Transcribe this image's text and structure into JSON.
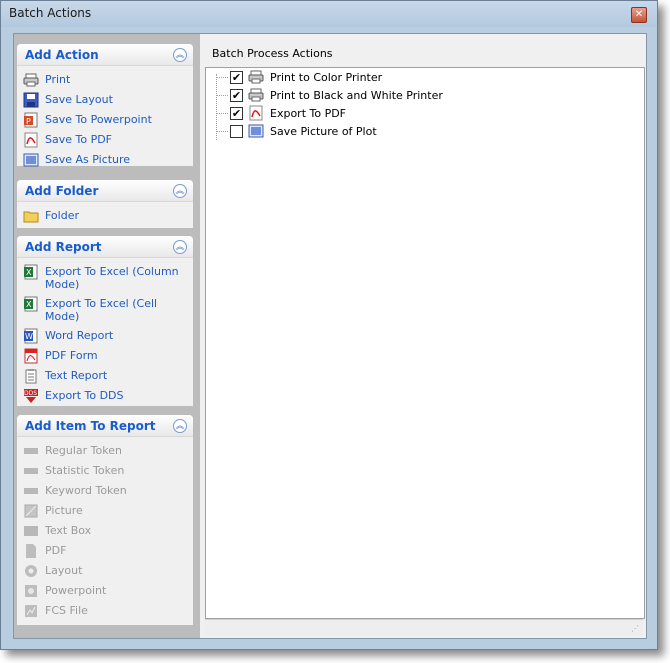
{
  "window": {
    "title": "Batch Actions"
  },
  "groups": {
    "add_action": {
      "title": "Add Action",
      "items": [
        {
          "label": "Print",
          "icon": "printer-icon"
        },
        {
          "label": "Save Layout",
          "icon": "floppy-disk-icon"
        },
        {
          "label": "Save To Powerpoint",
          "icon": "powerpoint-icon"
        },
        {
          "label": "Save To PDF",
          "icon": "pdf-icon"
        },
        {
          "label": "Save As Picture",
          "icon": "picture-icon"
        }
      ]
    },
    "add_folder": {
      "title": "Add Folder",
      "items": [
        {
          "label": "Folder",
          "icon": "folder-icon"
        }
      ]
    },
    "add_report": {
      "title": "Add Report",
      "items": [
        {
          "label": "Export To Excel (Column Mode)",
          "icon": "excel-column-icon"
        },
        {
          "label": "Export To Excel (Cell Mode)",
          "icon": "excel-cell-icon"
        },
        {
          "label": "Word Report",
          "icon": "word-icon"
        },
        {
          "label": "PDF Form",
          "icon": "pdf-form-icon"
        },
        {
          "label": "Text Report",
          "icon": "text-report-icon"
        },
        {
          "label": "Export To DDS",
          "icon": "dds-icon"
        }
      ]
    },
    "add_item_to_report": {
      "title": "Add Item To Report",
      "items": [
        {
          "label": "Regular Token",
          "icon": "token-icon"
        },
        {
          "label": "Statistic Token",
          "icon": "token-icon"
        },
        {
          "label": "Keyword Token",
          "icon": "token-icon"
        },
        {
          "label": "Picture",
          "icon": "picture-icon"
        },
        {
          "label": "Text Box",
          "icon": "text-box-icon"
        },
        {
          "label": "PDF",
          "icon": "pdf-icon"
        },
        {
          "label": "Layout",
          "icon": "layout-icon"
        },
        {
          "label": "Powerpoint",
          "icon": "powerpoint-icon"
        },
        {
          "label": "FCS File",
          "icon": "fcs-file-icon"
        }
      ]
    }
  },
  "main": {
    "title": "Batch Process Actions",
    "actions": [
      {
        "label": "Print to Color Printer",
        "checked": true,
        "icon": "printer-icon"
      },
      {
        "label": "Print to Black and White Printer",
        "checked": true,
        "icon": "printer-icon"
      },
      {
        "label": "Export To PDF",
        "checked": true,
        "icon": "pdf-icon"
      },
      {
        "label": "Save Picture of Plot",
        "checked": false,
        "icon": "picture-icon"
      }
    ]
  },
  "colors": {
    "link": "#1f5bbf",
    "disabled": "#9a9a9a",
    "group_title": "#1a5ccc"
  }
}
